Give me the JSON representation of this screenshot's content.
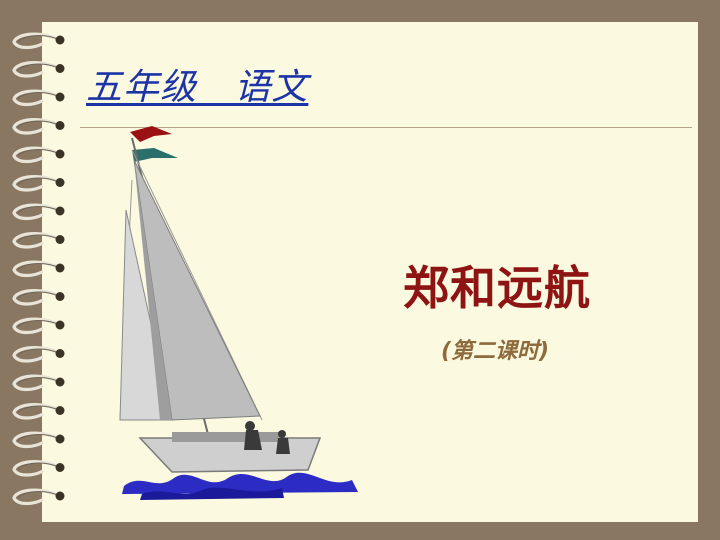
{
  "slide": {
    "header_title": "五年级   语文",
    "lesson_title": "郑和远航",
    "lesson_subtitle": "(第二课时)"
  },
  "decorations": {
    "binding_rings": 17,
    "clipart": "sailboat"
  },
  "colors": {
    "background": "#8a7762",
    "page": "#fbf9df",
    "header_text": "#1c34a8",
    "title_text": "#8e1313",
    "subtitle_text": "#8e6a3c"
  }
}
